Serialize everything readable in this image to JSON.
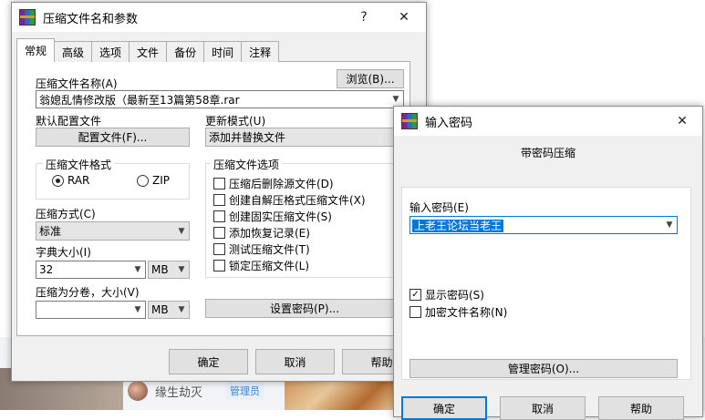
{
  "background": {
    "username": "缘生劫灭",
    "badge": "管理员"
  },
  "main_dialog": {
    "title": "压缩文件名和参数",
    "help_btn": "?",
    "close_btn": "✕",
    "tabs": [
      {
        "label": "常规"
      },
      {
        "label": "高级"
      },
      {
        "label": "选项"
      },
      {
        "label": "文件"
      },
      {
        "label": "备份"
      },
      {
        "label": "时间"
      },
      {
        "label": "注释"
      }
    ],
    "archive_name_label": "压缩文件名称(A)",
    "browse_btn": "浏览(B)...",
    "archive_name_value": "翁媳乱情修改版（最新至13篇第58章.rar",
    "profile_label": "默认配置文件",
    "profile_btn": "配置文件(F)...",
    "update_mode_label": "更新模式(U)",
    "update_mode_value": "添加并替换文件",
    "format_group_label": "压缩文件格式",
    "format_rar": "RAR",
    "format_zip": "ZIP",
    "options_group_label": "压缩文件选项",
    "options": [
      {
        "label": "压缩后删除源文件(D)",
        "checked": false
      },
      {
        "label": "创建自解压格式压缩文件(X)",
        "checked": false
      },
      {
        "label": "创建固实压缩文件(S)",
        "checked": false
      },
      {
        "label": "添加恢复记录(E)",
        "checked": false
      },
      {
        "label": "测试压缩文件(T)",
        "checked": false
      },
      {
        "label": "锁定压缩文件(L)",
        "checked": false
      }
    ],
    "method_label": "压缩方式(C)",
    "method_value": "标准",
    "dict_label": "字典大小(I)",
    "dict_value": "32",
    "dict_unit": "MB",
    "split_label": "压缩为分卷，大小(V)",
    "split_value": "",
    "split_unit": "MB",
    "set_password_btn": "设置密码(P)...",
    "ok_btn": "确定",
    "cancel_btn": "取消",
    "help_bottom_btn": "帮助"
  },
  "password_dialog": {
    "title": "输入密码",
    "close_btn": "✕",
    "heading": "带密码压缩",
    "input_label": "输入密码(E)",
    "password_value": "上老王论坛当老王",
    "show_password": {
      "label": "显示密码(S)",
      "checked": true
    },
    "encrypt_names": {
      "label": "加密文件名称(N)",
      "checked": false
    },
    "manage_btn": "管理密码(O)...",
    "ok_btn": "确定",
    "cancel_btn": "取消",
    "help_btn": "帮助"
  }
}
